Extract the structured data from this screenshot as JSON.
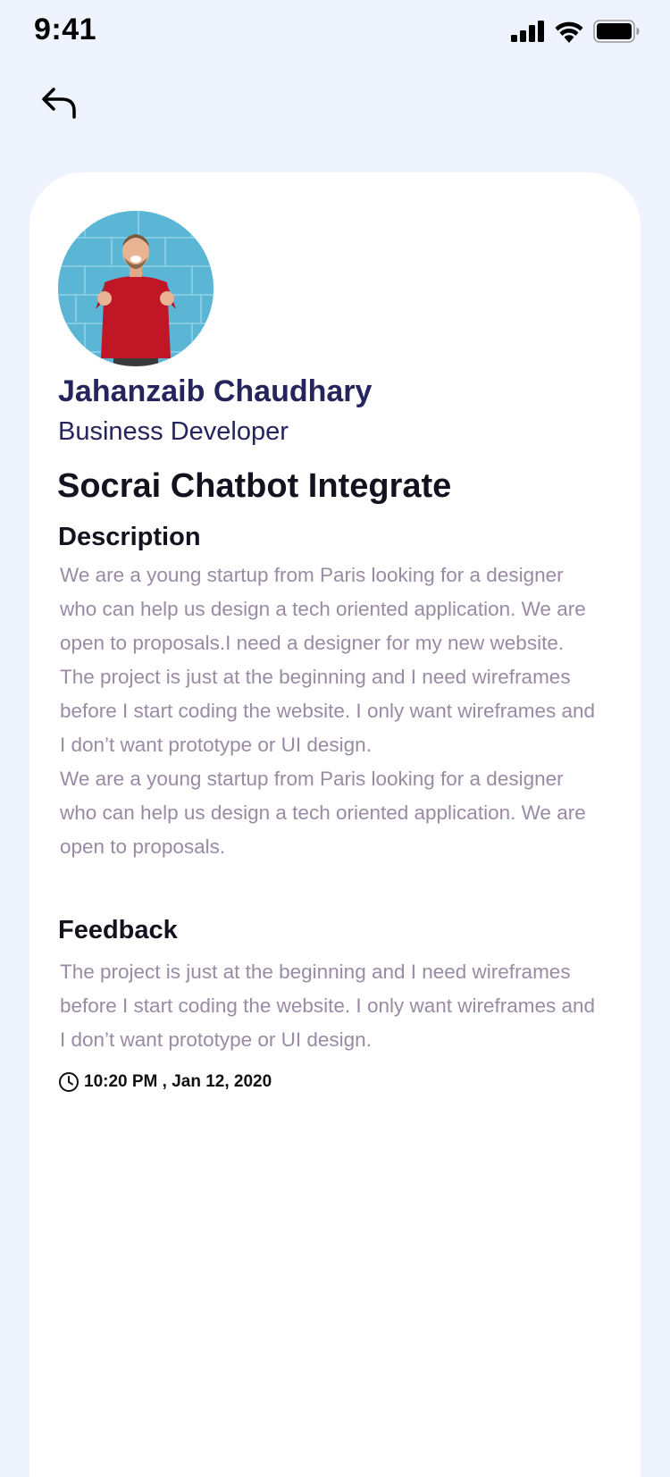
{
  "status_bar": {
    "time": "9:41",
    "icons": [
      "cellular-signal-icon",
      "wifi-icon",
      "battery-icon"
    ]
  },
  "nav": {
    "back_icon": "back-arrow-icon"
  },
  "profile": {
    "avatar": "avatar-photo",
    "name": "Jahanzaib Chaudhary",
    "role": "Business Developer"
  },
  "project": {
    "title": "Socrai Chatbot Integrate",
    "description_heading": "Description",
    "description_paragraphs": [
      "We are a young startup from Paris looking for a designer who can help us design a tech oriented application. We are open to proposals.I need a designer for my new website.",
      "The project is just at the beginning and I need wireframes before I start coding the website. I only want wireframes and I don’t want prototype or UI design.",
      "We are a young startup from Paris looking for a designer who can help us design a tech oriented application. We are open to proposals."
    ],
    "feedback_heading": "Feedback",
    "feedback_text": "The project is just at the beginning and I need wireframes before I start coding the website. I only want wireframes and I don’t want prototype or UI design.",
    "timestamp": "10:20 PM , Jan 12, 2020",
    "timestamp_icon": "clock-icon"
  },
  "colors": {
    "background": "#eff3fe",
    "card": "#ffffff",
    "name_color": "#25245c",
    "heading_color": "#13121f",
    "body_color": "#9a8aa4"
  }
}
